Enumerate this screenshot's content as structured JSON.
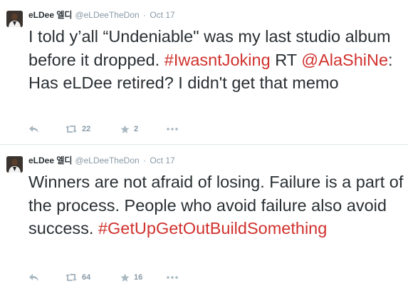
{
  "tweets": [
    {
      "name": "eLDee 엘디",
      "handle": "@eLDeeTheDon",
      "separator": "·",
      "time": "Oct 17",
      "text_parts": [
        "I told y’all “Undeniable\" was my last studio album before it dropped. ",
        "#IwasntJoking",
        " RT ",
        "@AlaShiNe",
        ": Has eLDee retired? I didn't get that memo"
      ],
      "retweets": "22",
      "favorites": "2"
    },
    {
      "name": "eLDee 엘디",
      "handle": "@eLDeeTheDon",
      "separator": "·",
      "time": "Oct 17",
      "text_parts": [
        "Winners are not afraid of losing. Failure is a part of the process. People who avoid failure also avoid success. ",
        "#GetUpGetOutBuildSomething"
      ],
      "retweets": "64",
      "favorites": "16"
    }
  ],
  "icons": {
    "reply": "reply-icon",
    "retweet": "retweet-icon",
    "favorite": "star-icon",
    "more": "more-icon"
  },
  "colors": {
    "hashtag": "#d0312d",
    "muted": "#8899a6",
    "text": "#292f33"
  }
}
